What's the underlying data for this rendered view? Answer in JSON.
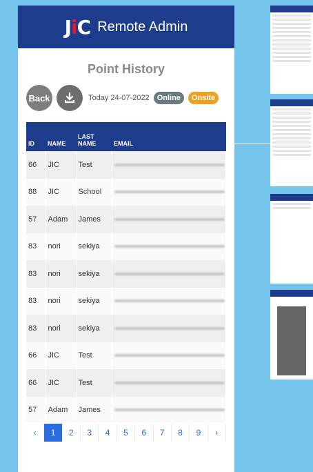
{
  "header": {
    "logo": "JiC",
    "title": "Remote Admin"
  },
  "page_title": "Point History",
  "toolbar": {
    "back_label": "Back",
    "date_text": "Today 24-07-2022",
    "online_label": "Online",
    "onsite_label": "Onsite"
  },
  "table": {
    "headers": {
      "id": "ID",
      "name": "NAME",
      "last_name": "LAST NAME",
      "email": "EMAIL"
    },
    "rows": [
      {
        "id": "66",
        "name": "JIC",
        "last_name": "Test"
      },
      {
        "id": "88",
        "name": "JIC",
        "last_name": "School"
      },
      {
        "id": "57",
        "name": "Adam",
        "last_name": "James"
      },
      {
        "id": "83",
        "name": "nori",
        "last_name": "sekiya"
      },
      {
        "id": "83",
        "name": "nori",
        "last_name": "sekiya"
      },
      {
        "id": "83",
        "name": "nori",
        "last_name": "sekiya"
      },
      {
        "id": "83",
        "name": "nori",
        "last_name": "sekiya"
      },
      {
        "id": "66",
        "name": "JIC",
        "last_name": "Test"
      },
      {
        "id": "66",
        "name": "JIC",
        "last_name": "Test"
      },
      {
        "id": "57",
        "name": "Adam",
        "last_name": "James"
      }
    ]
  },
  "pagination": {
    "prev": "‹",
    "pages": [
      "1",
      "2",
      "3",
      "4",
      "5",
      "6",
      "7",
      "8",
      "9"
    ],
    "next": "›",
    "active": "1"
  },
  "colors": {
    "header": "#1e3c8c",
    "accent": "#2a6be0",
    "onsite": "#f0a020",
    "background": "#74c4ec"
  }
}
